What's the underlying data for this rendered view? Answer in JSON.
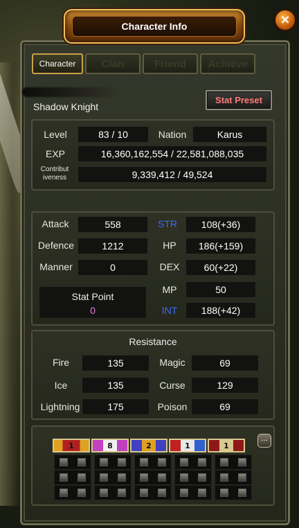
{
  "window": {
    "title": "Character Info",
    "close_glyph": "×"
  },
  "tabs": [
    {
      "label": "Character",
      "active": true
    },
    {
      "label": "Clan",
      "active": false
    },
    {
      "label": "Friend",
      "active": false
    },
    {
      "label": "Achieve",
      "active": false
    }
  ],
  "character": {
    "class_name": "Shadow Knight",
    "stat_preset_label": "Stat Preset",
    "level_label": "Level",
    "level_value": "83 / 10",
    "nation_label": "Nation",
    "nation_value": "Karus",
    "exp_label": "EXP",
    "exp_value": "16,360,162,554 / 22,581,088,035",
    "contrib_label_line1": "Contribut",
    "contrib_label_line2": "iveness",
    "contrib_value": "9,339,412 / 49,524"
  },
  "stats": {
    "attack_label": "Attack",
    "attack_value": "558",
    "defence_label": "Defence",
    "defence_value": "1212",
    "manner_label": "Manner",
    "manner_value": "0",
    "stat_point_label": "Stat Point",
    "stat_point_value": "0",
    "str_label": "STR",
    "str_value": "108(+36)",
    "hp_label": "HP",
    "hp_value": "186(+159)",
    "dex_label": "DEX",
    "dex_value": "60(+22)",
    "mp_label": "MP",
    "mp_value": "50",
    "int_label": "INT",
    "int_value": "188(+42)"
  },
  "resistance": {
    "title": "Resistance",
    "fire_label": "Fire",
    "fire_value": "135",
    "ice_label": "Ice",
    "ice_value": "135",
    "lightning_label": "Lightning",
    "lightning_value": "175",
    "magic_label": "Magic",
    "magic_value": "69",
    "curse_label": "Curse",
    "curse_value": "129",
    "poison_label": "Poison",
    "poison_value": "69"
  },
  "badges": [
    {
      "text": "1",
      "colors": [
        "#e0a020",
        "#b02020"
      ]
    },
    {
      "text": "8",
      "colors": [
        "#c040c0",
        "#f0f0f0"
      ]
    },
    {
      "text": "2",
      "colors": [
        "#4040c0",
        "#e0a020"
      ]
    },
    {
      "text": "1",
      "colors": [
        "#c02020",
        "#3060d0"
      ]
    },
    {
      "text": "1",
      "colors": [
        "#901818",
        "#d8c890"
      ]
    }
  ],
  "colors": {
    "accent_title": "#c98a2e",
    "stat_preset_text": "#ff7a7a",
    "blue_stat": "#3b6cf5",
    "stat_point_value": "#e07ad8"
  },
  "icons": {
    "close": "close-icon",
    "chat": "chat-bubble-icon"
  }
}
